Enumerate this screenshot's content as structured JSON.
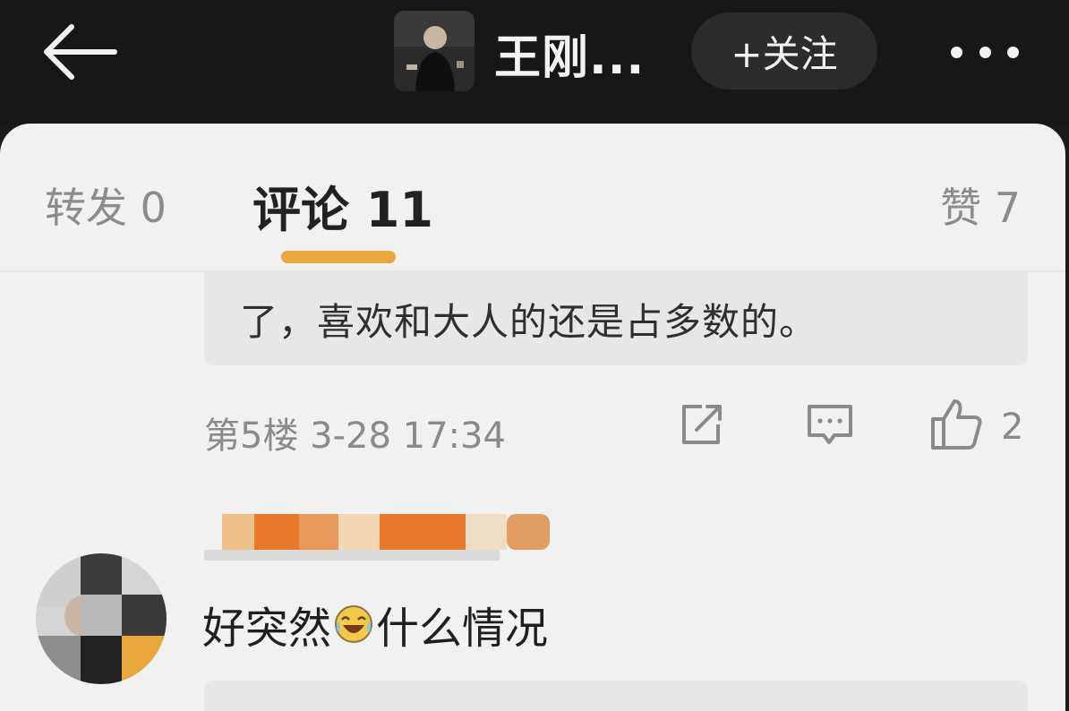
{
  "header": {
    "title": "王刚...",
    "follow_label": "+关注"
  },
  "tabs": {
    "repost": "转发 0",
    "comment": "评论 11",
    "like": "赞 7"
  },
  "comment_1": {
    "quoted_text": "了，喜欢和大人的还是占多数的。",
    "meta": "第5楼 3-28 17:34",
    "like_count": "2"
  },
  "comment_2": {
    "text_before": "好突然",
    "emoji": "laughing-crying-emoji",
    "text_after": "什么情况"
  },
  "colors": {
    "accent": "#e9a73c",
    "top_bar": "#171717",
    "sheet": "#f1f1f1"
  }
}
